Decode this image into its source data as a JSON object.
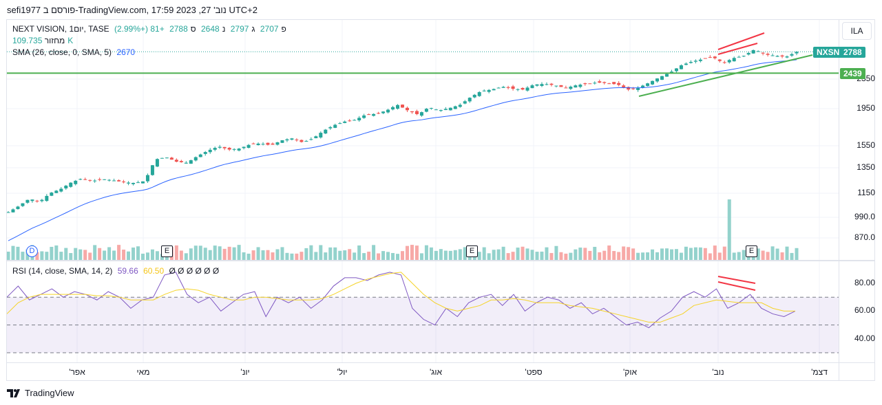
{
  "caption": "sefi1977 פורסם ב-TradingView.com, 17:59 2023 ,27 'נוב UTC+2",
  "legend": {
    "symbol": "NEXT VISION, 1יום, TASE",
    "open_l": "פ",
    "open": "2707",
    "high_l": "ג",
    "high": "2797",
    "low_l": "נ",
    "low": "2648",
    "close_l": "ס",
    "close": "2788",
    "change": "+81 (+2.99%)",
    "volume_l": "מחזור",
    "volume": "109.735K",
    "sma_l": "SMA (26, close, 0, SMA, 5)",
    "sma": "2670"
  },
  "rsi_legend": {
    "label": "RSI (14, close, SMA, 14, 2)",
    "rsi": "59.66",
    "rsi_sma": "60.50",
    "empty": "Ø Ø Ø Ø Ø Ø"
  },
  "currency": "ILA",
  "price_axis": [
    "2350",
    "1950",
    "1550",
    "1350",
    "1150",
    "990.0",
    "870.0"
  ],
  "rsi_axis": [
    "80.00",
    "60.00",
    "40.00"
  ],
  "tags": {
    "symbol": "NXSN",
    "last": "2788",
    "hline": "2439"
  },
  "x_axis": [
    "'אפר",
    "מאי",
    "'יונ",
    "'יול",
    "'אוג",
    "'ספט",
    "'אוק",
    "'נוב",
    "'דצמ"
  ],
  "events": [
    "D",
    "E",
    "E",
    "E"
  ],
  "colors": {
    "up": "#26a69a",
    "down": "#ef5350",
    "sma": "#2962ff",
    "rsi": "#7e57c2",
    "rsi_sma": "#f5d327",
    "line": "#4caf50",
    "red": "#f23645"
  },
  "logo": "TradingView",
  "chart_data": {
    "type": "candlestick",
    "closes": [
      1020,
      1060,
      1110,
      1090,
      1150,
      1180,
      1230,
      1260,
      1240,
      1255,
      1245,
      1230,
      1225,
      1240,
      1420,
      1440,
      1400,
      1390,
      1450,
      1500,
      1540,
      1510,
      1520,
      1560,
      1570,
      1550,
      1600,
      1620,
      1580,
      1620,
      1700,
      1760,
      1800,
      1820,
      1880,
      1890,
      1930,
      2000,
      1930,
      1880,
      1970,
      1930,
      1960,
      2000,
      2100,
      2180,
      2200,
      2240,
      2210,
      2200,
      2270,
      2280,
      2260,
      2220,
      2260,
      2280,
      2300,
      2290,
      2270,
      2200,
      2230,
      2300,
      2380,
      2450,
      2560,
      2620,
      2660,
      2700,
      2600,
      2680,
      2720,
      2830,
      2740,
      2720,
      2700,
      2788
    ],
    "sma_start": 840,
    "hline": 2439,
    "rsi": [
      70,
      78,
      68,
      72,
      76,
      70,
      74,
      72,
      68,
      74,
      70,
      62,
      68,
      70,
      86,
      88,
      72,
      66,
      70,
      60,
      66,
      72,
      74,
      56,
      70,
      66,
      70,
      62,
      68,
      78,
      84,
      84,
      82,
      86,
      88,
      86,
      62,
      54,
      50,
      62,
      56,
      66,
      70,
      72,
      64,
      72,
      60,
      66,
      70,
      68,
      62,
      66,
      58,
      62,
      56,
      50,
      52,
      48,
      55,
      60,
      70,
      74,
      70,
      76,
      62,
      66,
      72,
      62,
      58,
      56,
      60
    ],
    "rsi_sma": [
      58,
      66,
      70,
      72,
      72,
      72,
      72,
      72,
      71,
      71,
      70,
      68,
      68,
      68,
      72,
      75,
      76,
      75,
      72,
      70,
      68,
      68,
      70,
      70,
      69,
      68,
      68,
      68,
      69,
      72,
      76,
      80,
      83,
      85,
      87,
      88,
      80,
      72,
      66,
      62,
      60,
      62,
      64,
      68,
      68,
      69,
      68,
      66,
      66,
      66,
      64,
      63,
      62,
      60,
      58,
      56,
      54,
      52,
      52,
      55,
      58,
      64,
      66,
      68,
      67,
      66,
      66,
      66,
      62,
      60,
      60
    ],
    "volume_spike": 1.0
  }
}
